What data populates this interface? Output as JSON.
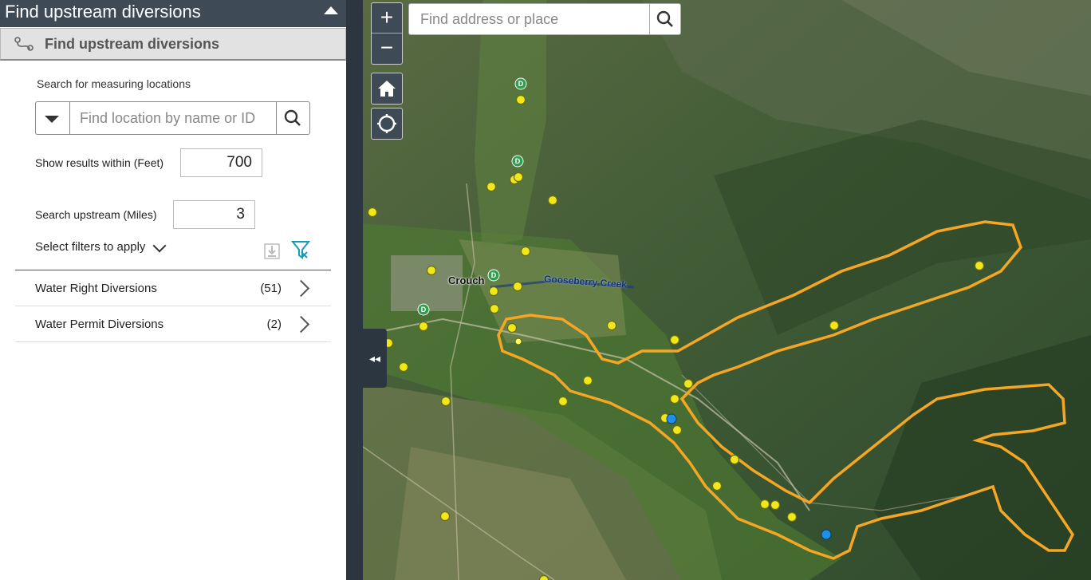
{
  "panel": {
    "title": "Find upstream diversions",
    "widget_title": "Find upstream diversions",
    "search_label": "Search for measuring locations",
    "location_placeholder": "Find location by name or ID",
    "distance_label": "Show results within (Feet)",
    "distance_value": "700",
    "upstream_label": "Search upstream (Miles)",
    "upstream_value": "3",
    "filters_label": "Select filters to apply",
    "results": [
      {
        "name": "Water Right Diversions",
        "count": "(51)"
      },
      {
        "name": "Water Permit Diversions",
        "count": "(2)"
      }
    ]
  },
  "map": {
    "zoom_in": "+",
    "zoom_out": "−",
    "address_placeholder": "Find address or place",
    "toggle_glyph": "◂◂",
    "labels": {
      "town": "Crouch",
      "creek": "Gooseberry Creek"
    },
    "marker_letter": "D",
    "colors": {
      "buffer": "#f5a623",
      "diversion_point": "#f0e81a",
      "permit_point": "#1e90e8",
      "station_marker": "#2e9e4f"
    }
  }
}
